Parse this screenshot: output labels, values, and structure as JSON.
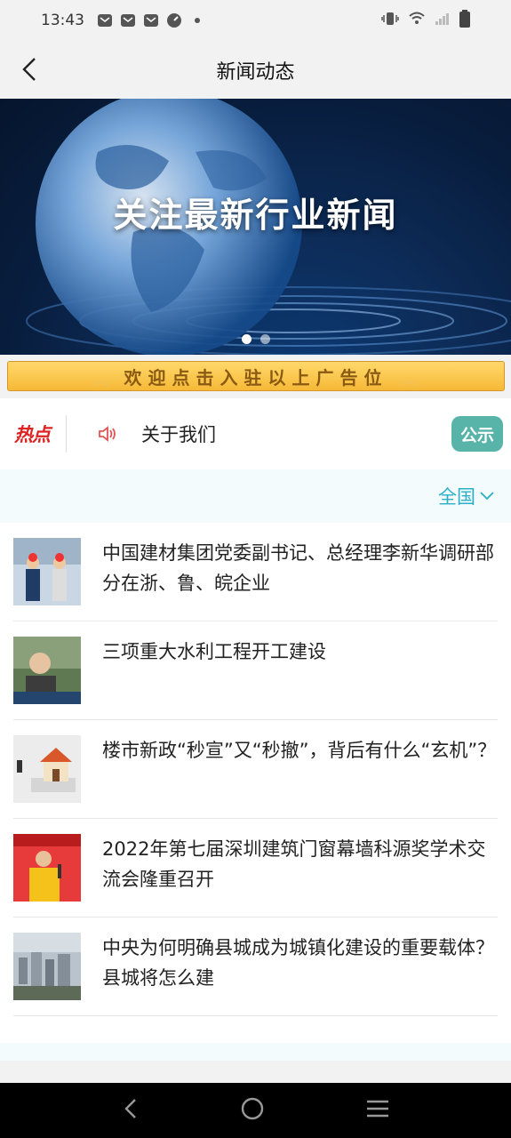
{
  "status": {
    "time": "13:43",
    "battery_color": "#444444"
  },
  "header": {
    "title": "新闻动态",
    "back_icon": "chevron-left-icon"
  },
  "banner": {
    "headline": "关注最新行业新闻",
    "slide_count": 2,
    "active_slide": 1
  },
  "ad": {
    "text": "欢迎点击入驻以上广告位"
  },
  "hot": {
    "logo": "热点",
    "announcement": "关于我们",
    "badge": "公示",
    "badge_color": "#58b3a9"
  },
  "filter": {
    "region": "全国",
    "accent": "#29b0c8"
  },
  "news": [
    {
      "title": "中国建材集团党委副书记、总经理李新华调研部分在浙、鲁、皖企业"
    },
    {
      "title": "三项重大水利工程开工建设"
    },
    {
      "title": "楼市新政“秒宣”又“秒撤”，背后有什么“玄机”？"
    },
    {
      "title": "2022年第七届深圳建筑门窗幕墙科源奖学术交流会隆重召开"
    },
    {
      "title": "中央为何明确县城成为城镇化建设的重要载体？县城将怎么建"
    }
  ]
}
